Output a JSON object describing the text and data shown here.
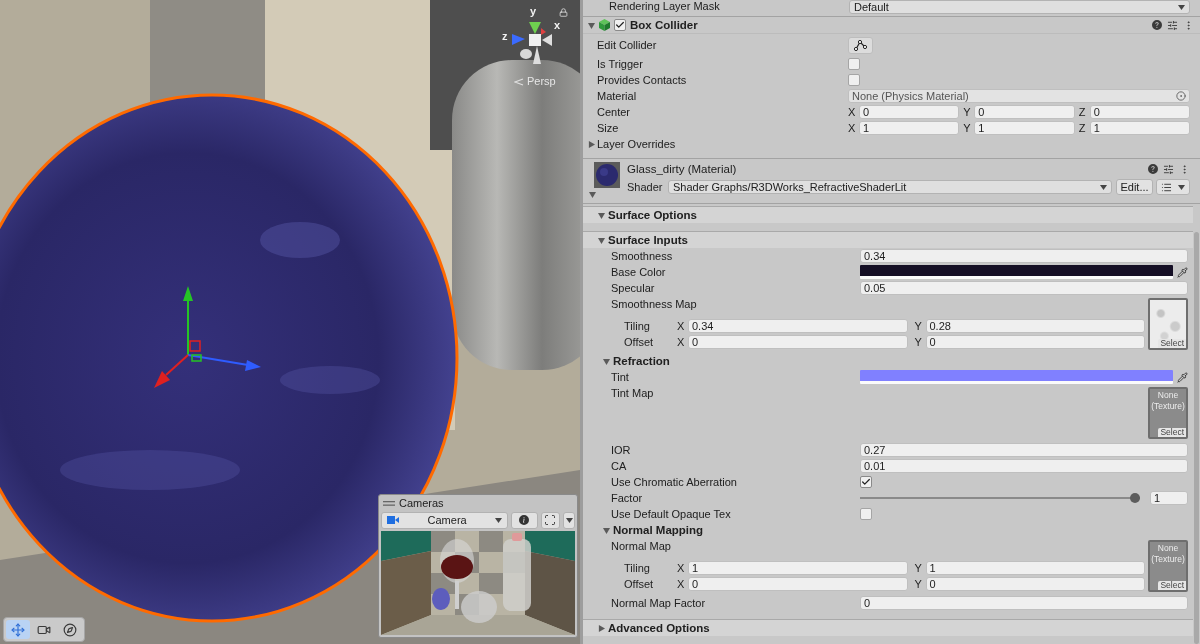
{
  "scene_view": {
    "axis_gizmo": {
      "axes": [
        {
          "label": "y"
        },
        {
          "label": "x"
        },
        {
          "label": "z"
        }
      ]
    },
    "projection": "Persp",
    "cameras_overlay": {
      "title": "Cameras",
      "camera": "Camera"
    },
    "tools": [
      {
        "selected": true
      },
      {
        "selected": false
      },
      {
        "selected": false
      }
    ]
  },
  "inspector": {
    "rendering_layer_mask": {
      "label": "Rendering Layer Mask",
      "value": "Default"
    },
    "box_collider": {
      "title": "Box Collider",
      "enabled": true,
      "expanded": true,
      "rows": [
        {
          "kind": "button",
          "label": "Edit Collider"
        },
        {
          "kind": "checkbox",
          "label": "Is Trigger",
          "checked": false
        },
        {
          "kind": "checkbox",
          "label": "Provides Contacts",
          "checked": false
        },
        {
          "kind": "object",
          "label": "Material",
          "value": "None (Physics Material)"
        },
        {
          "kind": "vector3",
          "label": "Center",
          "fields": [
            {
              "axis": "X",
              "value": "0"
            },
            {
              "axis": "Y",
              "value": "0"
            },
            {
              "axis": "Z",
              "value": "0"
            }
          ]
        },
        {
          "kind": "vector3",
          "label": "Size",
          "fields": [
            {
              "axis": "X",
              "value": "1"
            },
            {
              "axis": "Y",
              "value": "1"
            },
            {
              "axis": "Z",
              "value": "1"
            }
          ]
        },
        {
          "kind": "foldout",
          "label": "Layer Overrides",
          "expanded": false
        }
      ]
    },
    "material": {
      "name": "Glass_dirty (Material)",
      "expanded": true,
      "shader_label": "Shader",
      "shader": "Shader Graphs/R3DWorks_RefractiveShaderLit",
      "edit_button": "Edit...",
      "sections": [
        {
          "title": "Surface Options",
          "expanded": true
        },
        {
          "title": "Surface Inputs",
          "expanded": true,
          "children": [
            {
              "kind": "float",
              "label": "Smoothness",
              "value": "0.34"
            },
            {
              "kind": "color",
              "label": "Base Color",
              "color": "#150f25"
            },
            {
              "kind": "float",
              "label": "Specular",
              "value": "0.05"
            },
            {
              "kind": "texture",
              "label": "Smoothness Map",
              "texture": {
                "kind": "image",
                "select": "Select"
              },
              "tiling": {
                "label": "Tiling",
                "fields": [
                  {
                    "axis": "X",
                    "value": "0.34"
                  },
                  {
                    "axis": "Y",
                    "value": "0.28"
                  }
                ]
              },
              "offset": {
                "label": "Offset",
                "fields": [
                  {
                    "axis": "X",
                    "value": "0"
                  },
                  {
                    "axis": "Y",
                    "value": "0"
                  }
                ]
              }
            },
            {
              "kind": "group",
              "title": "Refraction",
              "expanded": true,
              "children": [
                {
                  "kind": "color",
                  "label": "Tint",
                  "color": "#8080ff"
                },
                {
                  "kind": "texture",
                  "label": "Tint Map",
                  "texture": {
                    "kind": "none",
                    "text": "None (Texture)",
                    "select": "Select"
                  }
                },
                {
                  "kind": "float",
                  "label": "IOR",
                  "value": "0.27"
                },
                {
                  "kind": "float",
                  "label": "CA",
                  "value": "0.01"
                },
                {
                  "kind": "checkbox",
                  "label": "Use Chromatic Aberration",
                  "checked": true
                },
                {
                  "kind": "slider",
                  "label": "Factor",
                  "level": 1,
                  "value": "1"
                },
                {
                  "kind": "checkbox",
                  "label": "Use Default Opaque Tex",
                  "checked": false
                }
              ]
            },
            {
              "kind": "group",
              "title": "Normal Mapping",
              "expanded": true,
              "children": [
                {
                  "kind": "texture",
                  "label": "Normal Map",
                  "texture": {
                    "kind": "none",
                    "text": "None (Texture)",
                    "select": "Select"
                  },
                  "tiling": {
                    "label": "Tiling",
                    "fields": [
                      {
                        "axis": "X",
                        "value": "1"
                      },
                      {
                        "axis": "Y",
                        "value": "1"
                      }
                    ]
                  },
                  "offset": {
                    "label": "Offset",
                    "fields": [
                      {
                        "axis": "X",
                        "value": "0"
                      },
                      {
                        "axis": "Y",
                        "value": "0"
                      }
                    ]
                  }
                },
                {
                  "kind": "float",
                  "label": "Normal Map Factor",
                  "value": "0"
                }
              ]
            }
          ]
        },
        {
          "title": "Advanced Options",
          "expanded": false
        }
      ]
    }
  }
}
